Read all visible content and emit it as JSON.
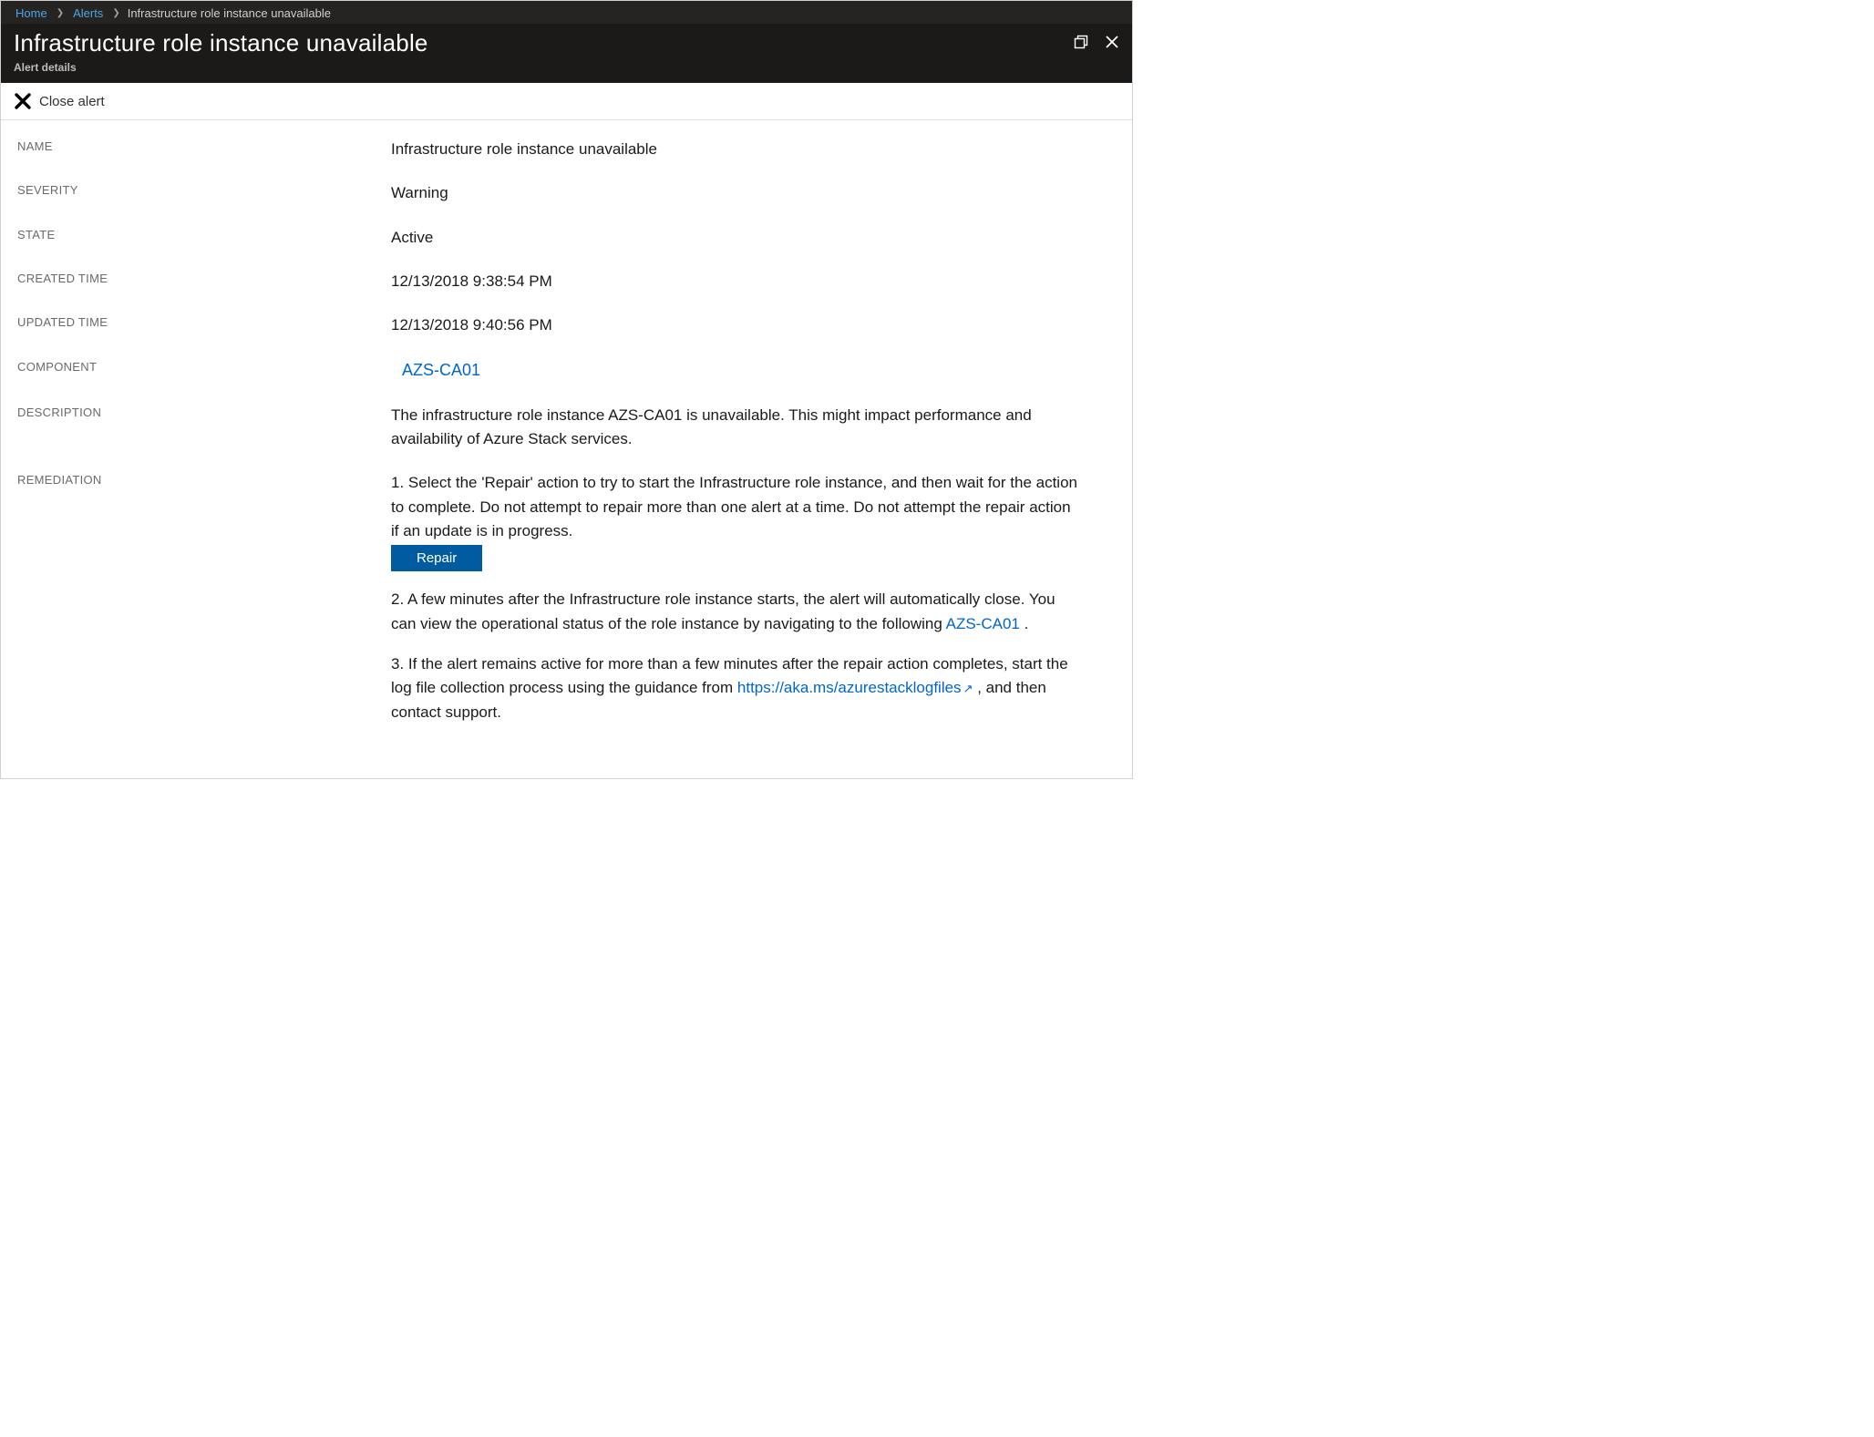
{
  "breadcrumb": {
    "home": "Home",
    "alerts": "Alerts",
    "current": "Infrastructure role instance unavailable"
  },
  "header": {
    "title": "Infrastructure role instance unavailable",
    "subtitle": "Alert details"
  },
  "toolbar": {
    "close_label": "Close alert"
  },
  "labels": {
    "name": "NAME",
    "severity": "SEVERITY",
    "state": "STATE",
    "created": "CREATED TIME",
    "updated": "UPDATED TIME",
    "component": "COMPONENT",
    "description": "DESCRIPTION",
    "remediation": "REMEDIATION"
  },
  "details": {
    "name": "Infrastructure role instance unavailable",
    "severity": "Warning",
    "state": "Active",
    "created": "12/13/2018 9:38:54 PM",
    "updated": "12/13/2018 9:40:56 PM",
    "component": "AZS-CA01",
    "description": "The infrastructure role instance AZS-CA01 is unavailable. This might impact performance and availability of Azure Stack services."
  },
  "remediation": {
    "step1": "1. Select the 'Repair' action to try to start the Infrastructure role instance, and then wait for the action to complete. Do not attempt to repair more than one alert at a time. Do not attempt the repair action if an update is in progress.",
    "repair_btn": "Repair",
    "step2_a": "2. A few minutes after the Infrastructure role instance starts, the alert will automatically close. You can view the operational status of the role instance by navigating to the following ",
    "step2_link": "AZS-CA01",
    "step2_b": " .",
    "step3_a": "3. If the alert remains active for more than a few minutes after the repair action completes, start the log file collection process using the guidance from ",
    "step3_link": "https://aka.ms/azurestacklogfiles",
    "step3_b": " , and then contact support."
  }
}
